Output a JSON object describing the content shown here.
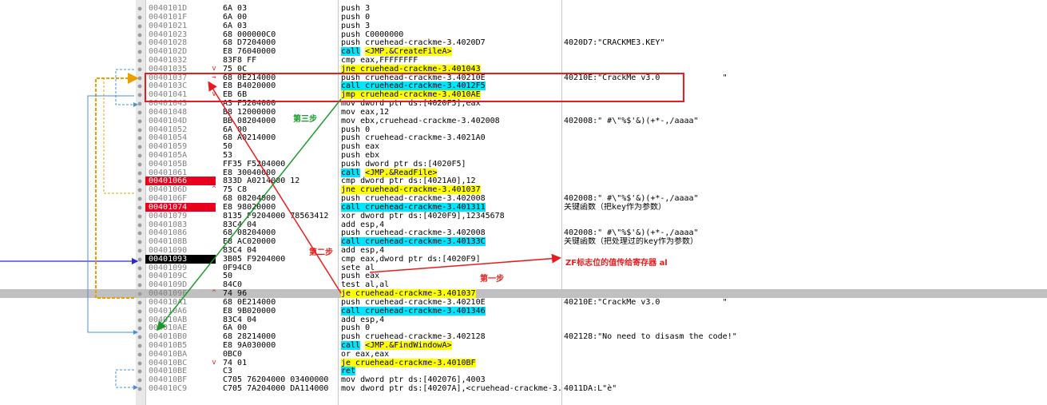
{
  "rows": [
    {
      "addr": "0040101D",
      "bytes": "6A 03",
      "ins": [
        {
          "t": "push 3"
        }
      ],
      "cmt": ""
    },
    {
      "addr": "0040101F",
      "bytes": "6A 00",
      "ins": [
        {
          "t": "push 0"
        }
      ],
      "cmt": ""
    },
    {
      "addr": "00401021",
      "bytes": "6A 03",
      "ins": [
        {
          "t": "push 3"
        }
      ],
      "cmt": ""
    },
    {
      "addr": "00401023",
      "bytes": "68 000000C0",
      "ins": [
        {
          "t": "push C0000000"
        }
      ],
      "cmt": ""
    },
    {
      "addr": "00401028",
      "bytes": "68 D7204000",
      "ins": [
        {
          "t": "push cruehead-crackme-3.4020D7"
        }
      ],
      "cmt": "4020D7:\"CRACKME3.KEY\""
    },
    {
      "addr": "0040102D",
      "bytes": "E8 76040000",
      "ins": [
        {
          "t": "call",
          "c": "call"
        },
        {
          "t": " "
        },
        {
          "t": "<JMP.&CreateFileA>",
          "c": "jmp"
        }
      ],
      "cmt": ""
    },
    {
      "addr": "00401032",
      "bytes": "83F8 FF",
      "ins": [
        {
          "t": "cmp eax,FFFFFFFF"
        }
      ],
      "cmt": ""
    },
    {
      "addr": "00401035",
      "bytes": "75 0C",
      "mark": "v",
      "ins": [
        {
          "t": "jne cruehead-crackme-3.401043",
          "c": "jmp"
        }
      ],
      "cmt": ""
    },
    {
      "addr": "00401037",
      "bytes": "68 0E214000",
      "mark": "→",
      "ins": [
        {
          "t": "push cruehead-crackme-3.40210E"
        }
      ],
      "cmt": "40210E:\"CrackMe v3.0             \""
    },
    {
      "addr": "0040103C",
      "bytes": "E8 B4020000",
      "ins": [
        {
          "t": "call cruehead-crackme-3.4012F5",
          "c": "call"
        }
      ],
      "cmt": ""
    },
    {
      "addr": "00401041",
      "bytes": "EB 6B",
      "mark": "v",
      "ins": [
        {
          "t": "jmp cruehead-crackme-3.4010AE",
          "c": "jmp"
        }
      ],
      "cmt": ""
    },
    {
      "addr": "00401043",
      "bytes": "A3 F5204000",
      "ins": [
        {
          "t": "mov dword ptr ds:[4020F5],eax"
        }
      ],
      "cmt": ""
    },
    {
      "addr": "00401048",
      "bytes": "B8 12000000",
      "ins": [
        {
          "t": "mov eax,12"
        }
      ],
      "cmt": ""
    },
    {
      "addr": "0040104D",
      "bytes": "BB 08204000",
      "ins": [
        {
          "t": "mov ebx,cruehead-crackme-3.402008"
        }
      ],
      "cmt": "402008:\" #\\\"%$'&)(+*-,/aaaa\""
    },
    {
      "addr": "00401052",
      "bytes": "6A 00",
      "ins": [
        {
          "t": "push 0"
        }
      ],
      "cmt": ""
    },
    {
      "addr": "00401054",
      "bytes": "68 A0214000",
      "ins": [
        {
          "t": "push cruehead-crackme-3.4021A0"
        }
      ],
      "cmt": ""
    },
    {
      "addr": "00401059",
      "bytes": "50",
      "ins": [
        {
          "t": "push eax"
        }
      ],
      "cmt": ""
    },
    {
      "addr": "0040105A",
      "bytes": "53",
      "ins": [
        {
          "t": "push ebx"
        }
      ],
      "cmt": ""
    },
    {
      "addr": "0040105B",
      "bytes": "FF35 F5204000",
      "ins": [
        {
          "t": "push dword ptr ds:[4020F5]"
        }
      ],
      "cmt": ""
    },
    {
      "addr": "00401061",
      "bytes": "E8 30040000",
      "ins": [
        {
          "t": "call",
          "c": "call"
        },
        {
          "t": " "
        },
        {
          "t": "<JMP.&ReadFile>",
          "c": "jmp"
        }
      ],
      "cmt": ""
    },
    {
      "addr": "00401066",
      "bytes": "833D A0214000 12",
      "addrStyle": "red",
      "ins": [
        {
          "t": "cmp dword ptr ds:[4021A0],12"
        }
      ],
      "cmt": ""
    },
    {
      "addr": "0040106D",
      "bytes": "75 C8",
      "mark": "^",
      "ins": [
        {
          "t": "jne cruehead-crackme-3.401037",
          "c": "jmp"
        }
      ],
      "cmt": ""
    },
    {
      "addr": "0040106F",
      "bytes": "68 08204000",
      "ins": [
        {
          "t": "push cruehead-crackme-3.402008"
        }
      ],
      "cmt": "402008:\" #\\\"%$'&)(+*-,/aaaa\""
    },
    {
      "addr": "00401074",
      "bytes": "E8 98020000",
      "addrStyle": "red",
      "ins": [
        {
          "t": "call cruehead-crackme-3.401311",
          "c": "call"
        }
      ],
      "cmt": "关键函数（把key作为参数）"
    },
    {
      "addr": "00401079",
      "bytes": "8135 F9204000 78563412",
      "ins": [
        {
          "t": "xor dword ptr ds:[4020F9],12345678"
        }
      ],
      "cmt": ""
    },
    {
      "addr": "00401083",
      "bytes": "83C4 04",
      "ins": [
        {
          "t": "add esp,4"
        }
      ],
      "cmt": ""
    },
    {
      "addr": "00401086",
      "bytes": "68 08204000",
      "ins": [
        {
          "t": "push cruehead-crackme-3.402008"
        }
      ],
      "cmt": "402008:\" #\\\"%$'&)(+*-,/aaaa\""
    },
    {
      "addr": "0040108B",
      "bytes": "E8 AC020000",
      "ins": [
        {
          "t": "call cruehead-crackme-3.40133C",
          "c": "call"
        }
      ],
      "cmt": "关键函数（把处理过的key作为参数）"
    },
    {
      "addr": "00401090",
      "bytes": "83C4 04",
      "ins": [
        {
          "t": "add esp,4"
        }
      ],
      "cmt": ""
    },
    {
      "addr": "00401093",
      "bytes": "3B05 F9204000",
      "addrStyle": "black",
      "ins": [
        {
          "t": "cmp eax,dword ptr ds:[4020F9]"
        }
      ],
      "cmt": ""
    },
    {
      "addr": "00401099",
      "bytes": "0F94C0",
      "ins": [
        {
          "t": "sete al"
        }
      ],
      "cmt": ""
    },
    {
      "addr": "0040109C",
      "bytes": "50",
      "ins": [
        {
          "t": "push eax"
        }
      ],
      "cmt": ""
    },
    {
      "addr": "0040109D",
      "bytes": "84C0",
      "ins": [
        {
          "t": "test al,al"
        }
      ],
      "cmt": ""
    },
    {
      "addr": "0040109F",
      "bytes": "74 96",
      "mark": "^",
      "hl": true,
      "ins": [
        {
          "t": "je cruehead-crackme-3.401037",
          "c": "jmp"
        }
      ],
      "cmt": ""
    },
    {
      "addr": "004010A1",
      "bytes": "68 0E214000",
      "ins": [
        {
          "t": "push cruehead-crackme-3.40210E"
        }
      ],
      "cmt": "40210E:\"CrackMe v3.0             \""
    },
    {
      "addr": "004010A6",
      "bytes": "E8 9B020000",
      "ins": [
        {
          "t": "call cruehead-crackme-3.401346",
          "c": "call"
        }
      ],
      "cmt": ""
    },
    {
      "addr": "004010AB",
      "bytes": "83C4 04",
      "ins": [
        {
          "t": "add esp,4"
        }
      ],
      "cmt": ""
    },
    {
      "addr": "004010AE",
      "bytes": "6A 00",
      "ins": [
        {
          "t": "push 0"
        }
      ],
      "cmt": ""
    },
    {
      "addr": "004010B0",
      "bytes": "68 28214000",
      "ins": [
        {
          "t": "push cruehead-crackme-3.402128"
        }
      ],
      "cmt": "402128:\"No need to disasm the code!\""
    },
    {
      "addr": "004010B5",
      "bytes": "E8 9A030000",
      "ins": [
        {
          "t": "call",
          "c": "call"
        },
        {
          "t": " "
        },
        {
          "t": "<JMP.&FindWindowA>",
          "c": "jmp"
        }
      ],
      "cmt": ""
    },
    {
      "addr": "004010BA",
      "bytes": "0BC0",
      "ins": [
        {
          "t": "or eax,eax"
        }
      ],
      "cmt": ""
    },
    {
      "addr": "004010BC",
      "bytes": "74 01",
      "mark": "v",
      "ins": [
        {
          "t": "je cruehead-crackme-3.4010BF",
          "c": "jmp"
        }
      ],
      "cmt": ""
    },
    {
      "addr": "004010BE",
      "bytes": "C3",
      "ins": [
        {
          "t": "ret",
          "c": "call"
        }
      ],
      "cmt": ""
    },
    {
      "addr": "004010BF",
      "bytes": "C705 76204000 03400000",
      "ins": [
        {
          "t": "mov dword ptr ds:[402076],4003"
        }
      ],
      "cmt": ""
    },
    {
      "addr": "004010C9",
      "bytes": "C705 7A204000 DA114000",
      "ins": [
        {
          "t": "mov dword ptr ds:[40207A],<cruehead-crackme-3.4011DA>"
        }
      ],
      "cmt": "4011DA:L\"è\""
    }
  ],
  "annotations": {
    "step1": "第一步",
    "step2": "第二步",
    "step3": "第三步",
    "zf_note": "ZF标志位的值传给寄存器 al"
  },
  "colors": {
    "call_bg": "#00e5ff",
    "jmp_bg": "#ffff00",
    "breakpoint_bg": "#e8001c",
    "current_bg": "#000000",
    "highlight_row": "#c0c0c0",
    "annotation_red": "#e81c1c",
    "annotation_green": "#1a9a2a"
  }
}
